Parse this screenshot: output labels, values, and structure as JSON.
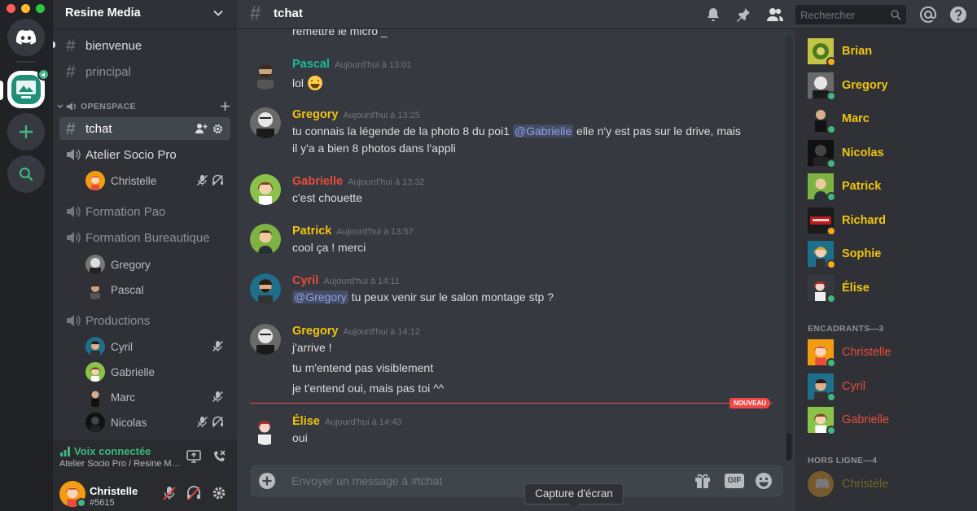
{
  "window": {
    "traffic_lights": [
      "#ff5f57",
      "#febc2e",
      "#28c840"
    ]
  },
  "rail": {
    "servers": [
      "discord-home",
      "resine-media",
      "add-server",
      "explore"
    ]
  },
  "server": {
    "name": "Resine Media",
    "channels_top": [
      {
        "name": "bienvenue",
        "type": "text"
      },
      {
        "name": "principal",
        "type": "text"
      }
    ],
    "category": "OPENSPACE",
    "active_channel": "tchat",
    "voice_channels": [
      {
        "name": "Atelier Socio Pro",
        "users": [
          "Christelle"
        ]
      },
      {
        "name": "Formation Pao",
        "users": []
      },
      {
        "name": "Formation Bureautique",
        "users": [
          "Gregory",
          "Pascal"
        ]
      },
      {
        "name": "Productions",
        "users": [
          "Cyril",
          "Gabrielle",
          "Marc",
          "Nicolas"
        ]
      }
    ]
  },
  "voice_panel": {
    "status": "Voix connectée",
    "location": "Atelier Socio Pro / Resine Media"
  },
  "user_panel": {
    "name": "Christelle",
    "tag": "#5615"
  },
  "topbar": {
    "channel": "tchat",
    "search_placeholder": "Rechercher"
  },
  "messages": {
    "partial_top": "remettre le micro _",
    "items": [
      {
        "author": "Pascal",
        "color": "#1abc9c",
        "time": "Aujourd'hui à 13:01",
        "lines": [
          "lol"
        ]
      },
      {
        "author": "Gregory",
        "color": "#f1c40f",
        "time": "Aujourd'hui à 13:25",
        "lines": [
          "tu connais la légende de la photo 8 du poi1",
          "@Gabrielle",
          "elle n'y est pas sur le drive, mais",
          "il y'a a bien 8 photos dans l'appli"
        ]
      },
      {
        "author": "Gabrielle",
        "color": "#e74c3c",
        "time": "Aujourd'hui à 13:32",
        "lines": [
          "c'est chouette"
        ]
      },
      {
        "author": "Patrick",
        "color": "#f1c40f",
        "time": "Aujourd'hui à 13:57",
        "lines": [
          "cool ça ! merci"
        ]
      },
      {
        "author": "Cyril",
        "color": "#e74c3c",
        "time": "Aujourd'hui à 14:11",
        "lines": [
          "@Gregory",
          "tu peux venir sur le salon montage stp ?"
        ]
      },
      {
        "author": "Gregory",
        "color": "#f1c40f",
        "time": "Aujourd'hui à 14:12",
        "lines": [
          "j'arrive !",
          "tu m'entend pas visiblement",
          "je t'entend oui, mais pas toi ^^"
        ]
      },
      {
        "author": "Élise",
        "color": "#f1c40f",
        "time": "Aujourd'hui à 14:43",
        "lines": [
          "oui"
        ]
      }
    ],
    "new_badge": "NOUVEAU"
  },
  "composer": {
    "placeholder": "Envoyer un message à #tchat",
    "gif_label": "GIF"
  },
  "tooltip": "Capture d'écran",
  "members": {
    "online": [
      {
        "name": "Brian",
        "color": "#f1c40f",
        "status": "#faa61a"
      },
      {
        "name": "Gregory",
        "color": "#f1c40f",
        "status": "#43b581"
      },
      {
        "name": "Marc",
        "color": "#f1c40f",
        "status": "#43b581"
      },
      {
        "name": "Nicolas",
        "color": "#f1c40f",
        "status": "#43b581"
      },
      {
        "name": "Patrick",
        "color": "#f1c40f",
        "status": "#43b581"
      },
      {
        "name": "Richard",
        "color": "#f1c40f",
        "status": "#faa61a"
      },
      {
        "name": "Sophie",
        "color": "#f1c40f",
        "status": "#faa61a"
      },
      {
        "name": "Élise",
        "color": "#f1c40f",
        "status": "#43b581"
      }
    ],
    "group_encadrants": "ENCADRANTS—3",
    "encadrants": [
      {
        "name": "Christelle",
        "color": "#e74c3c",
        "status": "#43b581"
      },
      {
        "name": "Cyril",
        "color": "#e74c3c",
        "status": "#43b581"
      },
      {
        "name": "Gabrielle",
        "color": "#e74c3c",
        "status": "#43b581"
      }
    ],
    "group_offline": "HORS LIGNE—4",
    "offline": [
      {
        "name": "Christèle",
        "color": "#f1c40f"
      }
    ]
  }
}
